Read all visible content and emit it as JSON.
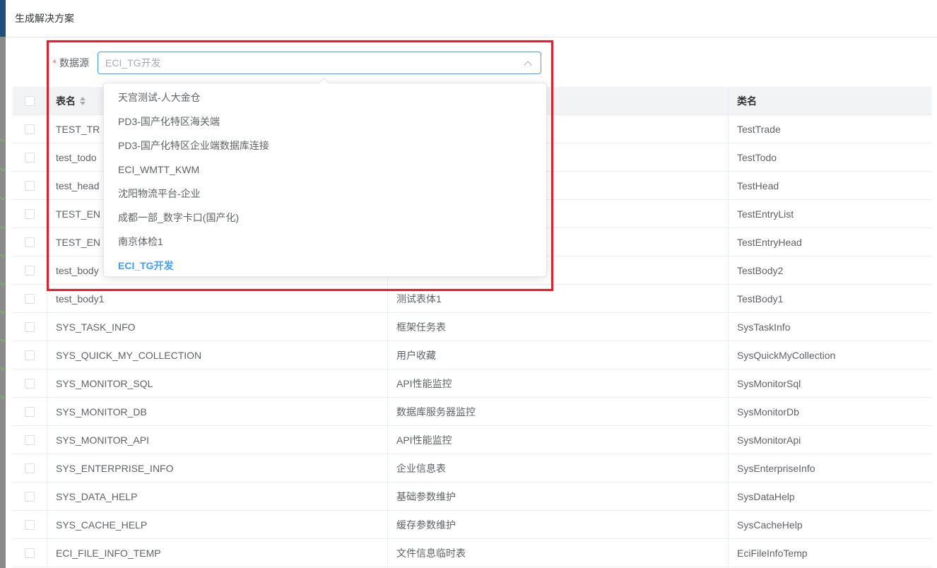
{
  "dialog": {
    "title": "生成解决方案"
  },
  "form": {
    "required_mark": "*",
    "datasource_label": "数据源",
    "datasource_value": "ECI_TG开发"
  },
  "dropdown": {
    "options": [
      "天宫测试-人大金仓",
      "PD3-国产化特区海关端",
      "PD3-国产化特区企业端数据库连接",
      "ECI_WMTT_KWM",
      "沈阳物流平台-企业",
      "成都一部_数字卡口(国产化)",
      "南京体检1",
      "ECI_TG开发"
    ],
    "selected": "ECI_TG开发"
  },
  "table": {
    "headers": {
      "table_name": "表名",
      "description": "",
      "class_name": "类名"
    },
    "rows": [
      {
        "table_name": "TEST_TR",
        "description": "",
        "class_name": "TestTrade"
      },
      {
        "table_name": "test_todo",
        "description": "",
        "class_name": "TestTodo"
      },
      {
        "table_name": "test_head",
        "description": "",
        "class_name": "TestHead"
      },
      {
        "table_name": "TEST_EN",
        "description": "",
        "class_name": "TestEntryList"
      },
      {
        "table_name": "TEST_EN",
        "description": "",
        "class_name": "TestEntryHead"
      },
      {
        "table_name": "test_body",
        "description": "",
        "class_name": "TestBody2"
      },
      {
        "table_name": "test_body1",
        "description": "测试表体1",
        "class_name": "TestBody1"
      },
      {
        "table_name": "SYS_TASK_INFO",
        "description": "框架任务表",
        "class_name": "SysTaskInfo"
      },
      {
        "table_name": "SYS_QUICK_MY_COLLECTION",
        "description": "用户收藏",
        "class_name": "SysQuickMyCollection"
      },
      {
        "table_name": "SYS_MONITOR_SQL",
        "description": "API性能监控",
        "class_name": "SysMonitorSql"
      },
      {
        "table_name": "SYS_MONITOR_DB",
        "description": "数据库服务器监控",
        "class_name": "SysMonitorDb"
      },
      {
        "table_name": "SYS_MONITOR_API",
        "description": "API性能监控",
        "class_name": "SysMonitorApi"
      },
      {
        "table_name": "SYS_ENTERPRISE_INFO",
        "description": "企业信息表",
        "class_name": "SysEnterpriseInfo"
      },
      {
        "table_name": "SYS_DATA_HELP",
        "description": "基础参数维护",
        "class_name": "SysDataHelp"
      },
      {
        "table_name": "SYS_CACHE_HELP",
        "description": "缓存参数维护",
        "class_name": "SysCacheHelp"
      },
      {
        "table_name": "ECI_FILE_INFO_TEMP",
        "description": "文件信息临时表",
        "class_name": "EciFileInfoTemp"
      }
    ]
  },
  "colors": {
    "accent": "#409eff",
    "highlight": "#e0202a",
    "required": "#f56c6c"
  }
}
